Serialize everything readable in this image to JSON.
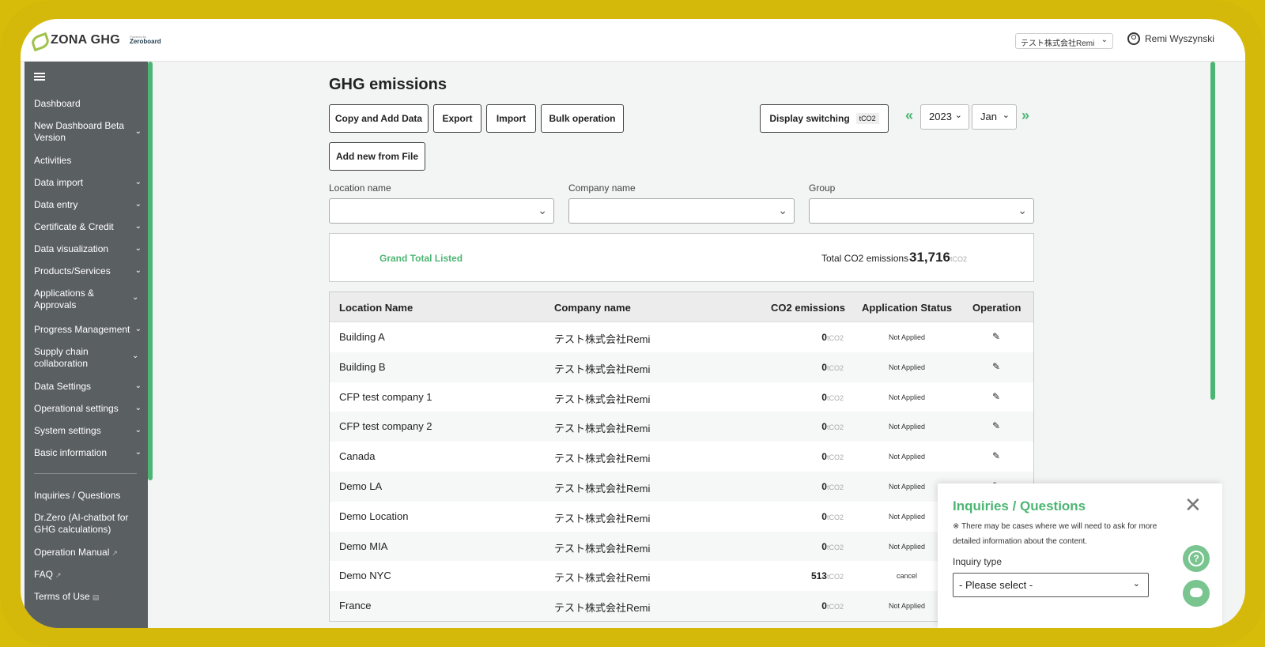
{
  "header": {
    "logo_text": "ZONA GHG",
    "logo_powered": "Powered by",
    "logo_zeroboard": "Zeroboard",
    "company_select": "テスト株式会社Remi",
    "user_name": "Remi Wyszynski"
  },
  "sidebar": {
    "items": [
      {
        "label": "Dashboard"
      },
      {
        "label": "New Dashboard Beta Version"
      },
      {
        "label": "Activities"
      },
      {
        "label": "Data import"
      },
      {
        "label": "Data entry"
      },
      {
        "label": "Certificate & Credit"
      },
      {
        "label": "Data visualization"
      },
      {
        "label": "Products/Services"
      },
      {
        "label": "Applications & Approvals"
      },
      {
        "label": "Progress Management"
      },
      {
        "label": "Supply chain collaboration"
      },
      {
        "label": "Data Settings"
      },
      {
        "label": "Operational settings"
      },
      {
        "label": "System settings"
      },
      {
        "label": "Basic information"
      }
    ],
    "bottom_items": [
      {
        "label": "Inquiries / Questions"
      },
      {
        "label": "Dr.Zero (AI-chatbot for GHG calculations)"
      },
      {
        "label": "Operation Manual"
      },
      {
        "label": "FAQ"
      },
      {
        "label": "Terms of Use"
      }
    ]
  },
  "main": {
    "title": "GHG emissions",
    "buttons": {
      "copy_add": "Copy and Add Data",
      "export": "Export",
      "import": "Import",
      "bulk": "Bulk operation",
      "add_file": "Add new from File",
      "display_switching": "Display switching",
      "display_unit": "tCO2"
    },
    "year": "2023",
    "month": "Jan",
    "filters": {
      "location_label": "Location name",
      "company_label": "Company name",
      "group_label": "Group"
    },
    "totals": {
      "label": "Grand Total Listed",
      "co2_label": "Total CO2 emissions",
      "co2_value": "31,716",
      "unit": "tCO2"
    },
    "table": {
      "headers": [
        "Location Name",
        "Company name",
        "CO2 emissions",
        "Application Status",
        "Operation"
      ],
      "unit": "tCO2",
      "rows": [
        {
          "location": "Building A",
          "company": "テスト株式会社Remi",
          "co2": "0",
          "status": "Not Applied"
        },
        {
          "location": "Building B",
          "company": "テスト株式会社Remi",
          "co2": "0",
          "status": "Not Applied"
        },
        {
          "location": "CFP test company 1",
          "company": "テスト株式会社Remi",
          "co2": "0",
          "status": "Not Applied"
        },
        {
          "location": "CFP test company 2",
          "company": "テスト株式会社Remi",
          "co2": "0",
          "status": "Not Applied"
        },
        {
          "location": "Canada",
          "company": "テスト株式会社Remi",
          "co2": "0",
          "status": "Not Applied"
        },
        {
          "location": "Demo LA",
          "company": "テスト株式会社Remi",
          "co2": "0",
          "status": "Not Applied"
        },
        {
          "location": "Demo Location",
          "company": "テスト株式会社Remi",
          "co2": "0",
          "status": "Not Applied"
        },
        {
          "location": "Demo MIA",
          "company": "テスト株式会社Remi",
          "co2": "0",
          "status": "Not Applied"
        },
        {
          "location": "Demo NYC",
          "company": "テスト株式会社Remi",
          "co2": "513",
          "status": "cancel"
        },
        {
          "location": "France",
          "company": "テスト株式会社Remi",
          "co2": "0",
          "status": "Not Applied"
        }
      ]
    }
  },
  "inquiry_panel": {
    "title": "Inquiries / Questions",
    "note": "※ There may be cases where we will need to ask for more detailed information about the content.",
    "type_label": "Inquiry type",
    "type_placeholder": "- Please select -"
  },
  "colors": {
    "accent": "#4cb573",
    "sidebar_bg": "#5a5f62",
    "frame": "#d4b90a"
  }
}
